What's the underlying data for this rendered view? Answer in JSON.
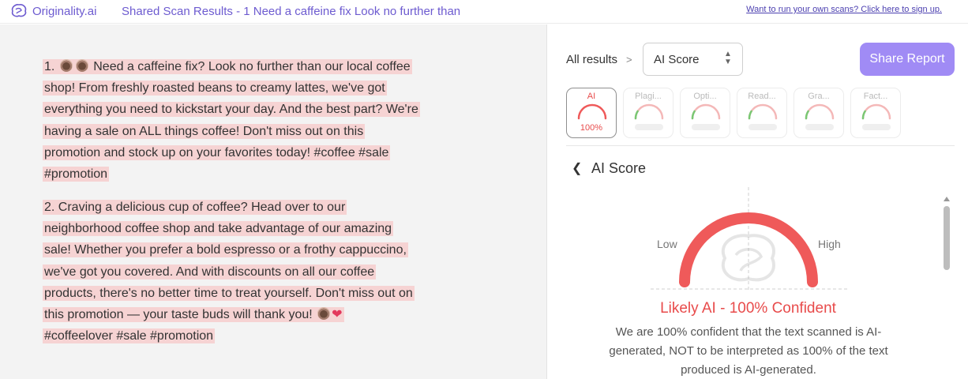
{
  "header": {
    "logo_text": "Originality.ai",
    "page_title": "Shared Scan Results - 1 Need a caffeine fix Look no further than",
    "signup_link": "Want to run your own scans? Click here to sign up."
  },
  "content": {
    "p1_lines": [
      "1. ☕☕ Need a caffeine fix? Look no further than our local coffee",
      "shop! From freshly roasted beans to creamy lattes, we've got",
      "everything you need to kickstart your day. And the best part? We're",
      "having a sale on ALL things coffee! Don't miss out on this",
      "promotion and stock up on your favorites today! #coffee #sale",
      "#promotion"
    ],
    "p2_lines": [
      "2. Craving a delicious cup of coffee? Head over to our",
      "neighborhood coffee shop and take advantage of our amazing",
      "sale! Whether you prefer a bold espresso or a frothy cappuccino,",
      "we've got you covered. And with discounts on all our coffee",
      "products, there's no better time to treat yourself. Don't miss out on",
      "this promotion — your taste buds will thank you! ☕❤",
      "#coffeelover #sale #promotion"
    ]
  },
  "results": {
    "breadcrumb_label": "All results",
    "breadcrumb_separator": ">",
    "selector_value": "AI Score",
    "share_button": "Share Report",
    "tabs": [
      {
        "label": "AI",
        "value": "100%",
        "active": true,
        "score": 1.0
      },
      {
        "label": "Plagi...",
        "value": "",
        "active": false,
        "score": 0.9
      },
      {
        "label": "Opti...",
        "value": "",
        "active": false,
        "score": 0.4
      },
      {
        "label": "Read...",
        "value": "",
        "active": false,
        "score": 0.7
      },
      {
        "label": "Gra...",
        "value": "",
        "active": false,
        "score": 0.5
      },
      {
        "label": "Fact...",
        "value": "",
        "active": false,
        "score": 0.9
      }
    ],
    "section_title": "AI Score",
    "gauge": {
      "low_label": "Low",
      "high_label": "High",
      "value": 1.0
    },
    "result_title": "Likely AI - 100% Confident",
    "result_desc_lines": [
      "We are 100% confident that the text scanned is AI-",
      "generated, NOT to be interpreted as 100% of the text",
      "produced is AI-generated."
    ]
  },
  "colors": {
    "brand": "#6d5bd0",
    "accent_button": "#a08bf5",
    "ai_red": "#e84b4b",
    "highlight": "#f6d3d3",
    "gauge_green": "#79c873",
    "gauge_pink": "#f4b8b8"
  }
}
